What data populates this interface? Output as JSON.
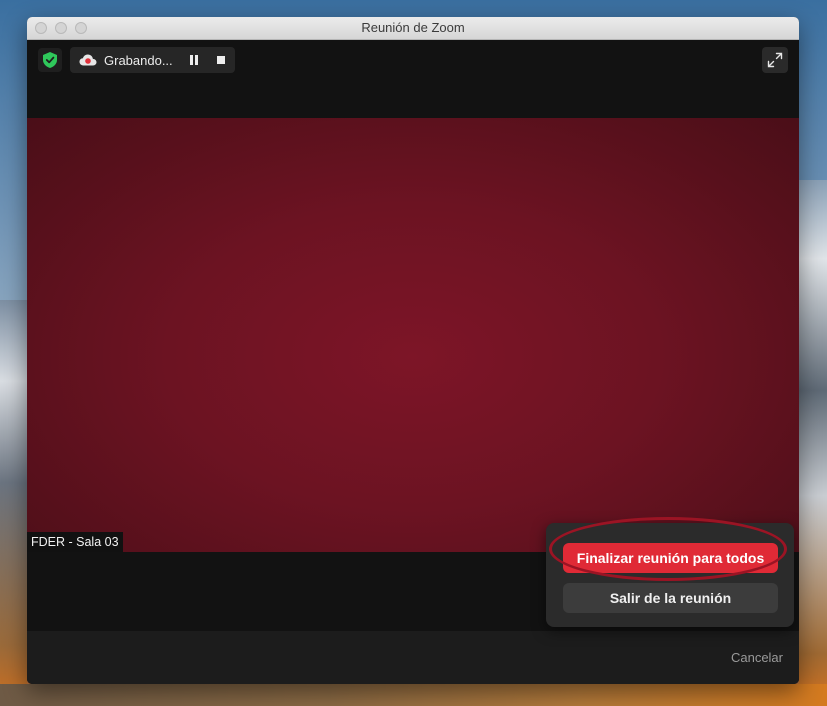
{
  "window": {
    "title": "Reunión de Zoom"
  },
  "toolbar": {
    "security_icon": "shield-check-icon",
    "recording_label": "Grabando...",
    "recording_icon": "cloud-record-icon",
    "pause_icon": "pause-icon",
    "stop_icon": "stop-icon",
    "fullscreen_icon": "expand-icon"
  },
  "video": {
    "participant_name": "FDER - Sala 03",
    "background_color": "#6c1322"
  },
  "end_menu": {
    "end_for_all_label": "Finalizar reunión para todos",
    "leave_label": "Salir de la reunión",
    "cancel_label": "Cancelar"
  },
  "colors": {
    "end_button": "#e02a36",
    "leave_button": "#3c3c3c",
    "security_green": "#2fc85b"
  }
}
